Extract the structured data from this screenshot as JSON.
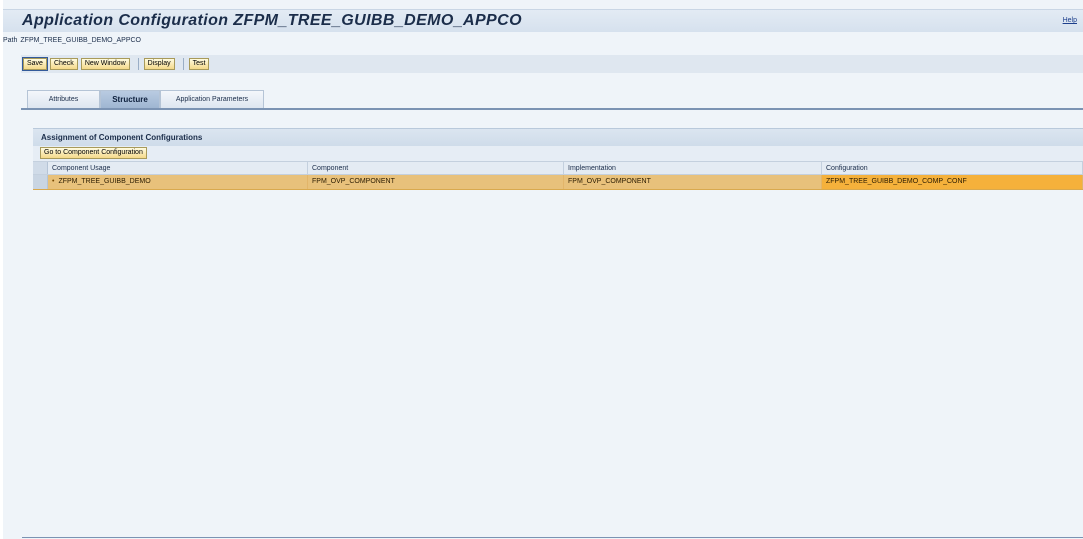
{
  "header": {
    "title": "Application Configuration ZFPM_TREE_GUIBB_DEMO_APPCO",
    "help_label": "Help"
  },
  "path": {
    "label": "Path",
    "value": "ZFPM_TREE_GUIBB_DEMO_APPCO"
  },
  "toolbar": {
    "save_label": "Save",
    "check_label": "Check",
    "new_window_label": "New Window",
    "display_label": "Display",
    "test_label": "Test"
  },
  "tabs": [
    {
      "label": "Attributes",
      "active": false
    },
    {
      "label": "Structure",
      "active": true
    },
    {
      "label": "Application Parameters",
      "active": false
    }
  ],
  "panel": {
    "title": "Assignment of Component Configurations",
    "goto_button_label": "Go to Component Configuration"
  },
  "table": {
    "columns": [
      "Component Usage",
      "Component",
      "Implementation",
      "Configuration"
    ],
    "rows": [
      {
        "component_usage": "ZFPM_TREE_GUIBB_DEMO",
        "component": "FPM_OVP_COMPONENT",
        "implementation": "FPM_OVP_COMPONENT",
        "configuration": "ZFPM_TREE_GUIBB_DEMO_COMP_CONF",
        "selected": true
      }
    ]
  },
  "colors": {
    "title_text": "#1b2d4a",
    "selected_row": "#e8c17b",
    "selected_cell": "#f5b13b",
    "button_fill": "#f5d98a",
    "active_tab": "#9fb6d2"
  }
}
